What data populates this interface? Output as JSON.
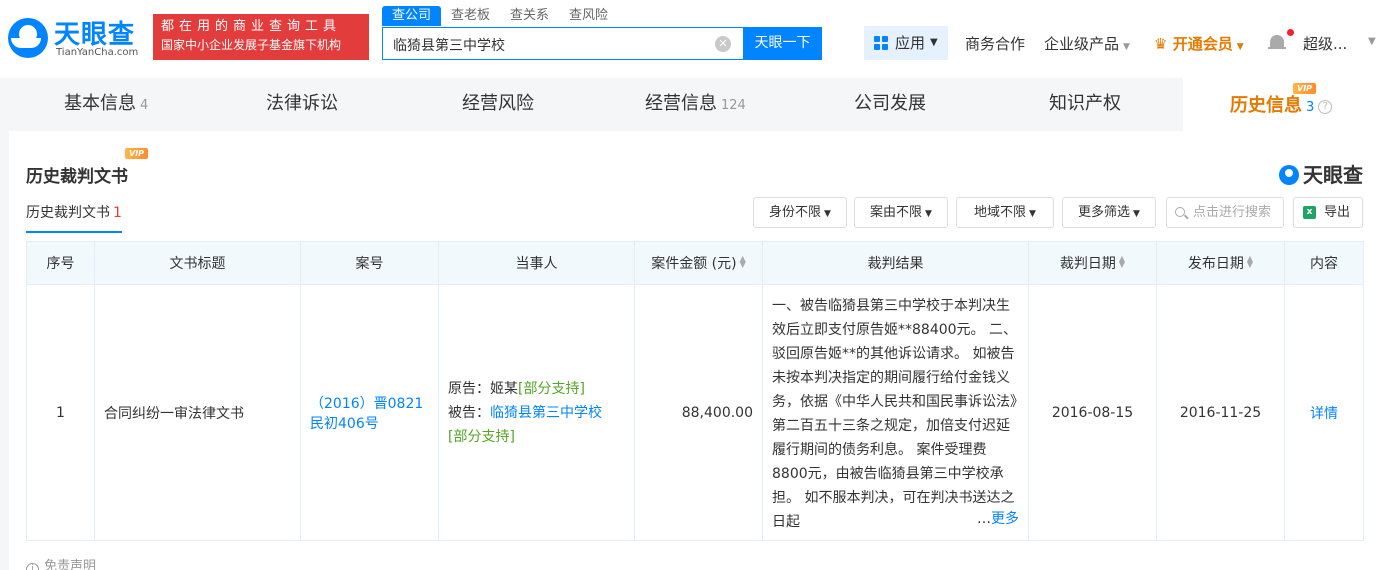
{
  "brand": {
    "name": "天眼查",
    "domain": "TianYanCha.com",
    "slogan_line1": "都在用的商业查询工具",
    "slogan_line2": "国家中小企业发展子基金旗下机构"
  },
  "search": {
    "tabs": [
      "查公司",
      "查老板",
      "查关系",
      "查风险"
    ],
    "value": "临猗县第三中学校",
    "button": "天眼一下"
  },
  "topnav": {
    "apps": "应用",
    "business": "商务合作",
    "enterprise": "企业级产品",
    "vip": "开通会员",
    "user": "超级..."
  },
  "categories": [
    {
      "label": "基本信息",
      "count": "4"
    },
    {
      "label": "法律诉讼",
      "count": ""
    },
    {
      "label": "经营风险",
      "count": ""
    },
    {
      "label": "经营信息",
      "count": "124"
    },
    {
      "label": "公司发展",
      "count": ""
    },
    {
      "label": "知识产权",
      "count": ""
    },
    {
      "label": "历史信息",
      "count": "3",
      "badge": "VIP"
    }
  ],
  "section": {
    "title": "历史裁判文书",
    "badge": "VIP",
    "watermark": "天眼查",
    "subtab_label": "历史裁判文书",
    "subtab_count": "1"
  },
  "filters": {
    "identity": "身份不限",
    "cause": "案由不限",
    "region": "地域不限",
    "more": "更多筛选",
    "search_placeholder": "点击进行搜索",
    "export": "导出"
  },
  "table": {
    "headers": [
      "序号",
      "文书标题",
      "案号",
      "当事人",
      "案件金额 (元)",
      "裁判结果",
      "裁判日期",
      "发布日期",
      "内容"
    ],
    "rows": [
      {
        "index": "1",
        "title": "合同纠纷一审法律文书",
        "case_no": "（2016）晋0821民初406号",
        "plaintiff_label": "原告：",
        "plaintiff": "姬某",
        "plaintiff_tag": "[部分支持]",
        "defendant_label": "被告：",
        "defendant": "临猗县第三中学校",
        "defendant_tag": "[部分支持]",
        "amount": "88,400.00",
        "result": "一、被告临猗县第三中学校于本判决生效后立即支付原告姬**88400元。 二、驳回原告姬**的其他诉讼请求。 如被告未按本判决指定的期间履行给付金钱义务，依据《中华人民共和国民事诉讼法》第二百五十三条之规定，加倍支付迟延履行期间的债务利息。 案件受理费8800元，由被告临猗县第三中学校承担。 如不服本判决，可在判决书送达之日起",
        "more": "更多",
        "judgment_date": "2016-08-15",
        "publish_date": "2016-11-25",
        "detail": "详情"
      }
    ]
  },
  "disclaimer": "免责声明"
}
